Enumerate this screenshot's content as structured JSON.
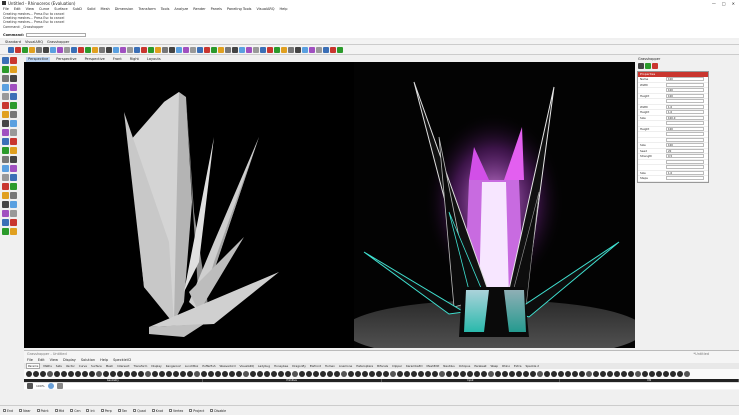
{
  "titlebar": {
    "title": "Untitled - Rhinoceros (Evaluation)",
    "min": "—",
    "max": "□",
    "close": "✕"
  },
  "menu": [
    "File",
    "Edit",
    "View",
    "Curve",
    "Surface",
    "SubD",
    "Solid",
    "Mesh",
    "Dimension",
    "Transform",
    "Tools",
    "Analyze",
    "Render",
    "Panels",
    "Paneling Tools",
    "VisualARQ",
    "Help"
  ],
  "command_history": [
    "Creating meshes... Press Esc to cancel",
    "Creating meshes... Press Esc to cancel",
    "Creating meshes... Press Esc to cancel",
    "Command: _Grasshopper"
  ],
  "command_prompt": "Command:",
  "tabs_top": [
    "Standard",
    "VisualARQ",
    "Grasshopper"
  ],
  "view_tabs": [
    {
      "label": "Perspective",
      "active": true
    },
    {
      "label": "Perspective",
      "active": false
    },
    {
      "label": "Perspective",
      "active": false
    },
    {
      "label": "Front",
      "active": false
    },
    {
      "label": "Right",
      "active": false
    },
    {
      "label": "Layouts",
      "active": false
    }
  ],
  "viewport_tag": "Perspective",
  "right_panel": {
    "header": "Grasshopper",
    "box_title": "Properties",
    "rows": [
      {
        "k": "Name",
        "v": "100"
      },
      {
        "k": "Width",
        "v": ""
      },
      {
        "k": "",
        "v": "100"
      },
      {
        "k": "Height",
        "v": "100"
      },
      {
        "k": "",
        "v": ""
      },
      {
        "k": "Width",
        "v": "1.0"
      },
      {
        "k": "Height",
        "v": "1.0"
      },
      {
        "k": "Size",
        "v": "100.0"
      },
      {
        "k": "",
        "v": ""
      },
      {
        "k": "Height",
        "v": "100"
      },
      {
        "k": "",
        "v": ""
      },
      {
        "k": "",
        "v": ""
      },
      {
        "k": "Size",
        "v": "100"
      },
      {
        "k": "Seed",
        "v": "20"
      },
      {
        "k": "Strength",
        "v": "0.5"
      },
      {
        "k": "",
        "v": ""
      },
      {
        "k": "",
        "v": ""
      },
      {
        "k": "Size",
        "v": "1.0"
      },
      {
        "k": "Steps",
        "v": ""
      }
    ]
  },
  "grasshopper": {
    "title": "Grasshopper - Untitled",
    "doc": "*Untitled",
    "menu": [
      "File",
      "Edit",
      "View",
      "Display",
      "Solution",
      "Help",
      "SpeckleV2"
    ],
    "tabs": [
      {
        "label": "Params",
        "active": true
      },
      {
        "label": "Maths"
      },
      {
        "label": "Sets"
      },
      {
        "label": "Vector"
      },
      {
        "label": "Curve"
      },
      {
        "label": "Surface"
      },
      {
        "label": "Mesh"
      },
      {
        "label": "Intersect"
      },
      {
        "label": "Transform"
      },
      {
        "label": "Display"
      },
      {
        "label": "Kangaroo2"
      },
      {
        "label": "LunchBox"
      },
      {
        "label": "Pufferfish"
      },
      {
        "label": "Weaverbird"
      },
      {
        "label": "VisualARQ"
      },
      {
        "label": "Ladybug"
      },
      {
        "label": "Honeybee"
      },
      {
        "label": "Dragonfly"
      },
      {
        "label": "Elefront"
      },
      {
        "label": "Human"
      },
      {
        "label": "Anemone"
      },
      {
        "label": "Heteroptera"
      },
      {
        "label": "Bifocals"
      },
      {
        "label": "Clipper"
      },
      {
        "label": "Karamba3D"
      },
      {
        "label": "MeshEdit"
      },
      {
        "label": "Nautilus"
      },
      {
        "label": "Octopus"
      },
      {
        "label": "Parakeet"
      },
      {
        "label": "Wasp"
      },
      {
        "label": "Rhino"
      },
      {
        "label": "Extra"
      },
      {
        "label": "Speckle 2"
      }
    ],
    "groups": [
      "Geometry",
      "Primitive",
      "Input",
      "Util"
    ],
    "zoom": "100%",
    "search_placeholder": ""
  },
  "statusbar": {
    "items": [
      "End",
      "Near",
      "Point",
      "Mid",
      "Cen",
      "Int",
      "Perp",
      "Tan",
      "Quad",
      "Knot",
      "Vertex",
      "Project",
      "Disable"
    ]
  },
  "colors": {
    "accent": "#c9362f",
    "viewport_bg": "#000000",
    "glow_pink": "#e35ff0",
    "glow_cyan": "#3fe0d0"
  },
  "icons": {
    "search": "search-icon",
    "gear": "gear-icon"
  }
}
